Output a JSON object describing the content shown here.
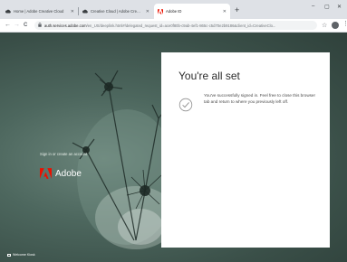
{
  "browser": {
    "tabs": [
      {
        "label": "Home | Adobe Creative Cloud",
        "active": false,
        "favicon": "creative-cloud-icon"
      },
      {
        "label": "Creative Cloud | Adobe Creative",
        "active": false,
        "favicon": "creative-cloud-icon"
      },
      {
        "label": "Adobe ID",
        "active": true,
        "favicon": "adobe-icon"
      }
    ],
    "new_tab": "+",
    "window_controls": {
      "minimize": "–",
      "maximize": "▢",
      "close": "✕"
    },
    "nav": {
      "back": "←",
      "forward": "→",
      "reload": "C"
    },
    "url": {
      "host": "auth.services.adobe.com",
      "path": "/en_US/deeplink.html#/delegated_request_id=ace0f80b-c9ab-4ef1-865c-c5d70e2b9186&client_id=CreativeClo..."
    },
    "bookmark_icon": "star-icon",
    "menu_icon": "⋮"
  },
  "page": {
    "brand": "Adobe",
    "brand_tagline": "Sign in or create an account",
    "footer": "Welcome Kiosk",
    "card": {
      "title": "You're all set",
      "message": "You've successfully signed in. Feel free to close this browser tab and return to where you previously left off.",
      "icon": "checkmark-circle-icon"
    }
  },
  "colors": {
    "adobe_red": "#eb1000",
    "card_bg": "#ffffff",
    "title_text": "#2c2c2c"
  }
}
